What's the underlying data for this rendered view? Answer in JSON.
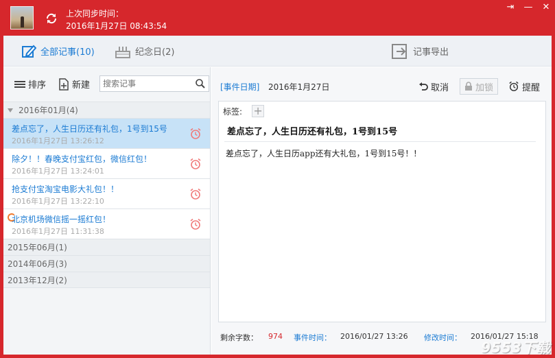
{
  "titlebar": {
    "sync_label": "上次同步时间：",
    "sync_time": "2016年1月27日 08:43:54",
    "icons": [
      "sync-icon",
      "pin-icon",
      "minimize-icon",
      "close-icon"
    ]
  },
  "tabs": [
    {
      "label": "全部记事(10)",
      "icon": "edit-icon",
      "active": true
    },
    {
      "label": "纪念日(2)",
      "icon": "cake-icon",
      "active": false
    },
    {
      "label": "记事导出",
      "icon": "export-icon",
      "active": false
    }
  ],
  "toolbar": {
    "sort_label": "排序",
    "new_label": "新建",
    "search_placeholder": "搜索记事"
  },
  "groups": [
    {
      "label": "2016年01月(4)",
      "expanded": true,
      "items": [
        {
          "title": "差点忘了，人生日历还有礼包，1号到15号",
          "date": "2016年1月27日 13:26:12",
          "selected": true
        },
        {
          "title": "除夕！！春晚支付宝红包，微信红包！",
          "date": "2016年1月27日 13:24:01",
          "selected": false
        },
        {
          "title": "抢支付宝淘宝电影大礼包！！",
          "date": "2016年1月27日 13:22:10",
          "selected": false
        },
        {
          "title": "北京机场微信摇一摇红包！",
          "date": "2016年1月27日 11:31:38",
          "selected": false
        }
      ]
    },
    {
      "label": "2015年06月(1)",
      "expanded": false
    },
    {
      "label": "2014年06月(3)",
      "expanded": false
    },
    {
      "label": "2013年12月(2)",
      "expanded": false
    }
  ],
  "detail": {
    "event_label": "[事件日期]",
    "event_date": "2016年1月27日",
    "cancel_label": "取消",
    "lock_label": "加锁",
    "remind_label": "提醒",
    "tag_label": "标签:",
    "tag_add": "+",
    "title": "差点忘了，人生日历还有礼包，1号到15号",
    "body": "差点忘了，人生日历app还有大礼包，1号到15号！！"
  },
  "footer": {
    "remain_label": "剩余字数：",
    "remain_value": "974",
    "event_time_label": "事件时间：",
    "event_time_value": "2016/01/27 13:26",
    "modify_time_label": "修改时间：",
    "modify_time_value": "2016/01/27 15:18"
  },
  "watermark": "9553下载",
  "colors": {
    "brand_red": "#d6272c",
    "accent_blue": "#1b7bd3",
    "selected_bg": "#c7e2f7",
    "alarm": "#f07a7a"
  }
}
